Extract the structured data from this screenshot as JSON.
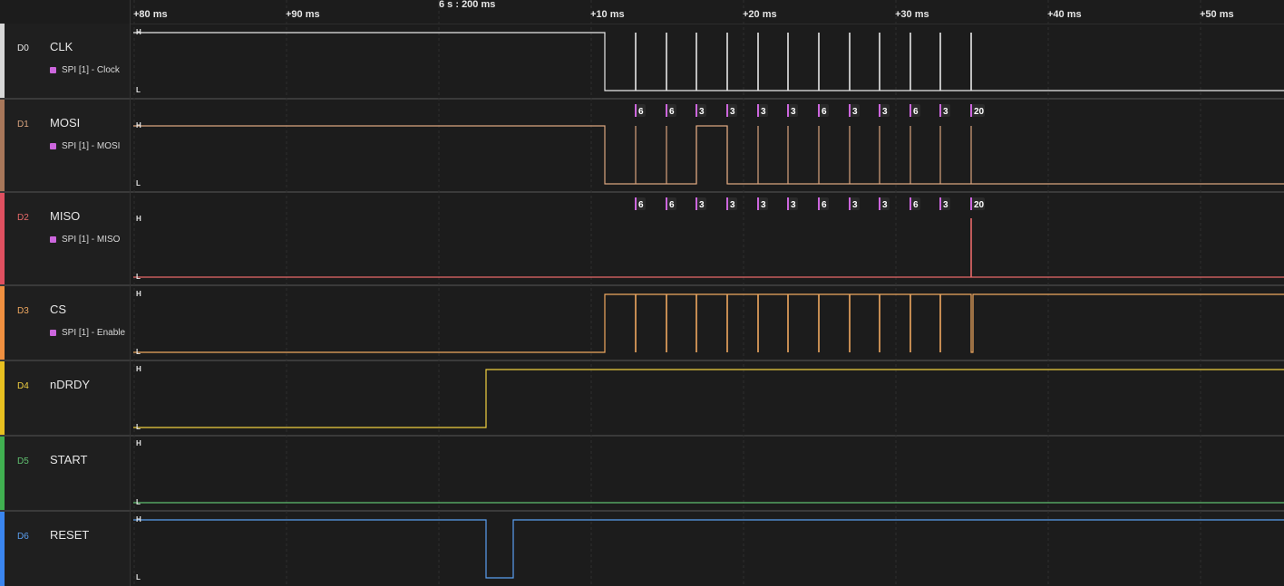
{
  "ruler": {
    "center_label": "6 s : 200 ms",
    "ticks": [
      "+80 ms",
      "+90 ms",
      "+10 ms",
      "+20 ms",
      "+30 ms",
      "+40 ms",
      "+50 ms"
    ]
  },
  "level_labels": {
    "high": "H",
    "low": "L"
  },
  "colors": {
    "background": "#1c1c1c",
    "grid": "#2e2e2e",
    "analyzer": "#cc66dd",
    "bubble": "#2a2a2a"
  },
  "channels": [
    {
      "id": "D0",
      "name": "CLK",
      "analyzer": "SPI [1] - Clock",
      "color": "#e8e8e8",
      "strip": "#d8d8d8"
    },
    {
      "id": "D1",
      "name": "MOSI",
      "analyzer": "SPI [1] - MOSI",
      "color": "#d9a47e",
      "strip": "#a8775a"
    },
    {
      "id": "D2",
      "name": "MISO",
      "analyzer": "SPI [1] - MISO",
      "color": "#e86a6a",
      "strip": "#e05060"
    },
    {
      "id": "D3",
      "name": "CS",
      "analyzer": "SPI [1] - Enable",
      "color": "#f0a860",
      "strip": "#f09040"
    },
    {
      "id": "D4",
      "name": "nDRDY",
      "analyzer": "",
      "color": "#f0d040",
      "strip": "#e8c020"
    },
    {
      "id": "D5",
      "name": "START",
      "analyzer": "",
      "color": "#60c070",
      "strip": "#40b050"
    },
    {
      "id": "D6",
      "name": "RESET",
      "analyzer": "",
      "color": "#5a9ef0",
      "strip": "#3a86f0"
    }
  ],
  "spi_bytes": {
    "mosi": [
      "6",
      "6",
      "3",
      "3",
      "3",
      "3",
      "6",
      "3",
      "3",
      "6",
      "3",
      "20"
    ],
    "miso": [
      "6",
      "6",
      "3",
      "3",
      "3",
      "3",
      "6",
      "3",
      "3",
      "6",
      "3",
      "20"
    ]
  }
}
